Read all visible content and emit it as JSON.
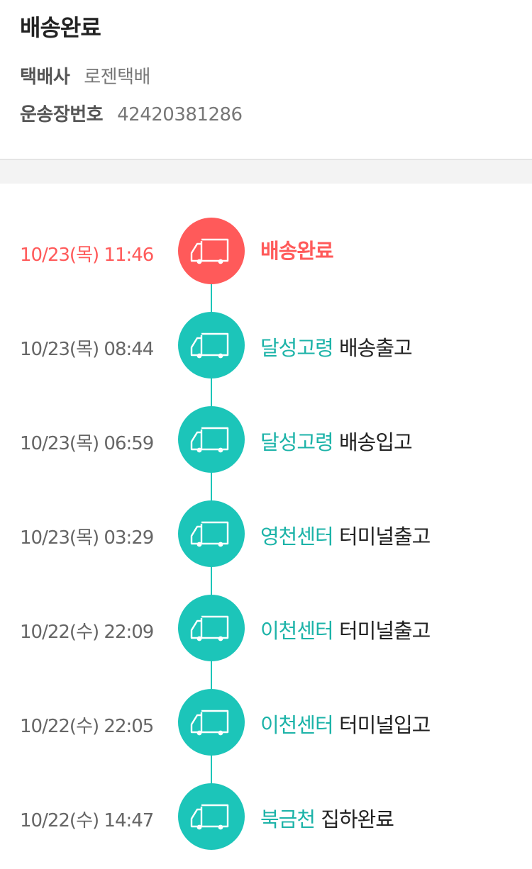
{
  "header": {
    "status_title": "배송완료",
    "carrier_label": "택배사",
    "carrier_value": "로젠택배",
    "tracking_label": "운송장번호",
    "tracking_value": "42420381286"
  },
  "colors": {
    "accent_teal": "#1cc5b9",
    "accent_red": "#ff5a5a",
    "location_text": "#1cb3a8"
  },
  "events": [
    {
      "time": "10/23(목) 11:46",
      "location": "",
      "status": "배송완료",
      "icon": "delivery-truck-icon"
    },
    {
      "time": "10/23(목) 08:44",
      "location": "달성고령",
      "status": "배송출고",
      "icon": "delivery-truck-icon"
    },
    {
      "time": "10/23(목) 06:59",
      "location": "달성고령",
      "status": "배송입고",
      "icon": "delivery-truck-icon"
    },
    {
      "time": "10/23(목) 03:29",
      "location": "영천센터",
      "status": "터미널출고",
      "icon": "delivery-truck-icon"
    },
    {
      "time": "10/22(수) 22:09",
      "location": "이천센터",
      "status": "터미널출고",
      "icon": "delivery-truck-icon"
    },
    {
      "time": "10/22(수) 22:05",
      "location": "이천센터",
      "status": "터미널입고",
      "icon": "delivery-truck-icon"
    },
    {
      "time": "10/22(수) 14:47",
      "location": "북금천",
      "status": "집하완료",
      "icon": "delivery-truck-icon"
    }
  ]
}
